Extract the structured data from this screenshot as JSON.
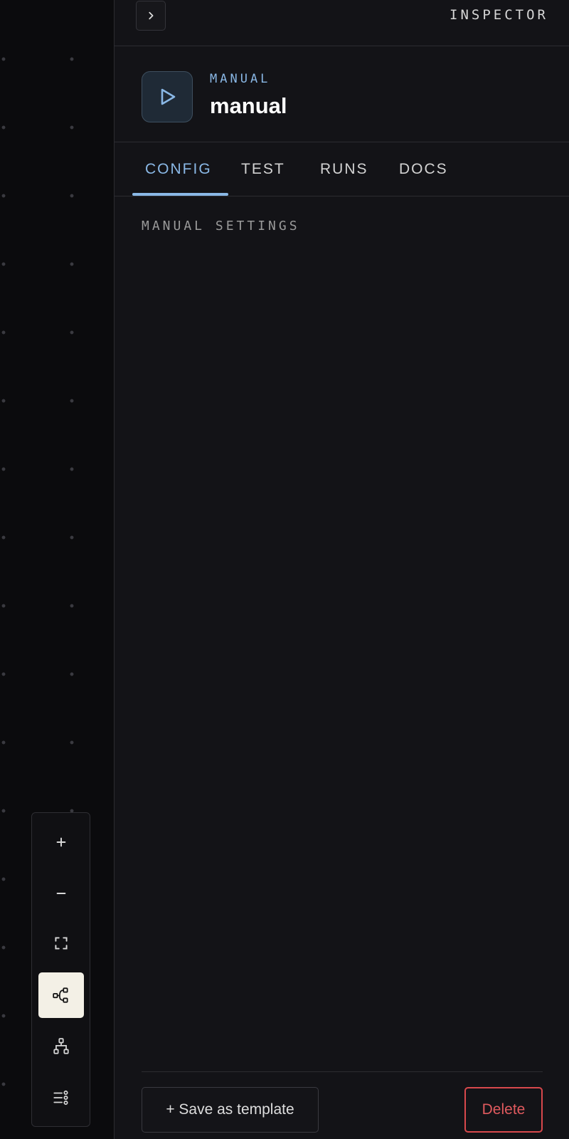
{
  "inspector": {
    "title": "INSPECTOR",
    "collapse_icon": "chevron-right-icon"
  },
  "node": {
    "kind": "MANUAL",
    "name": "manual",
    "icon": "play-icon",
    "accent_color": "#8ab8e6"
  },
  "tabs": [
    {
      "label": "CONFIG",
      "active": true
    },
    {
      "label": "TEST",
      "active": false
    },
    {
      "label": "RUNS",
      "active": false
    },
    {
      "label": "DOCS",
      "active": false
    }
  ],
  "config": {
    "section_label": "MANUAL SETTINGS"
  },
  "footer": {
    "save_template_label": "+ Save as template",
    "delete_label": "Delete",
    "delete_color": "#e05a5e"
  },
  "canvas_controls": [
    {
      "icon": "zoom-in-icon",
      "active": false
    },
    {
      "icon": "zoom-out-icon",
      "active": false
    },
    {
      "icon": "fit-view-icon",
      "active": false
    },
    {
      "icon": "horizontal-layout-icon",
      "active": true
    },
    {
      "icon": "vertical-layout-icon",
      "active": false
    },
    {
      "icon": "list-layout-icon",
      "active": false
    }
  ]
}
